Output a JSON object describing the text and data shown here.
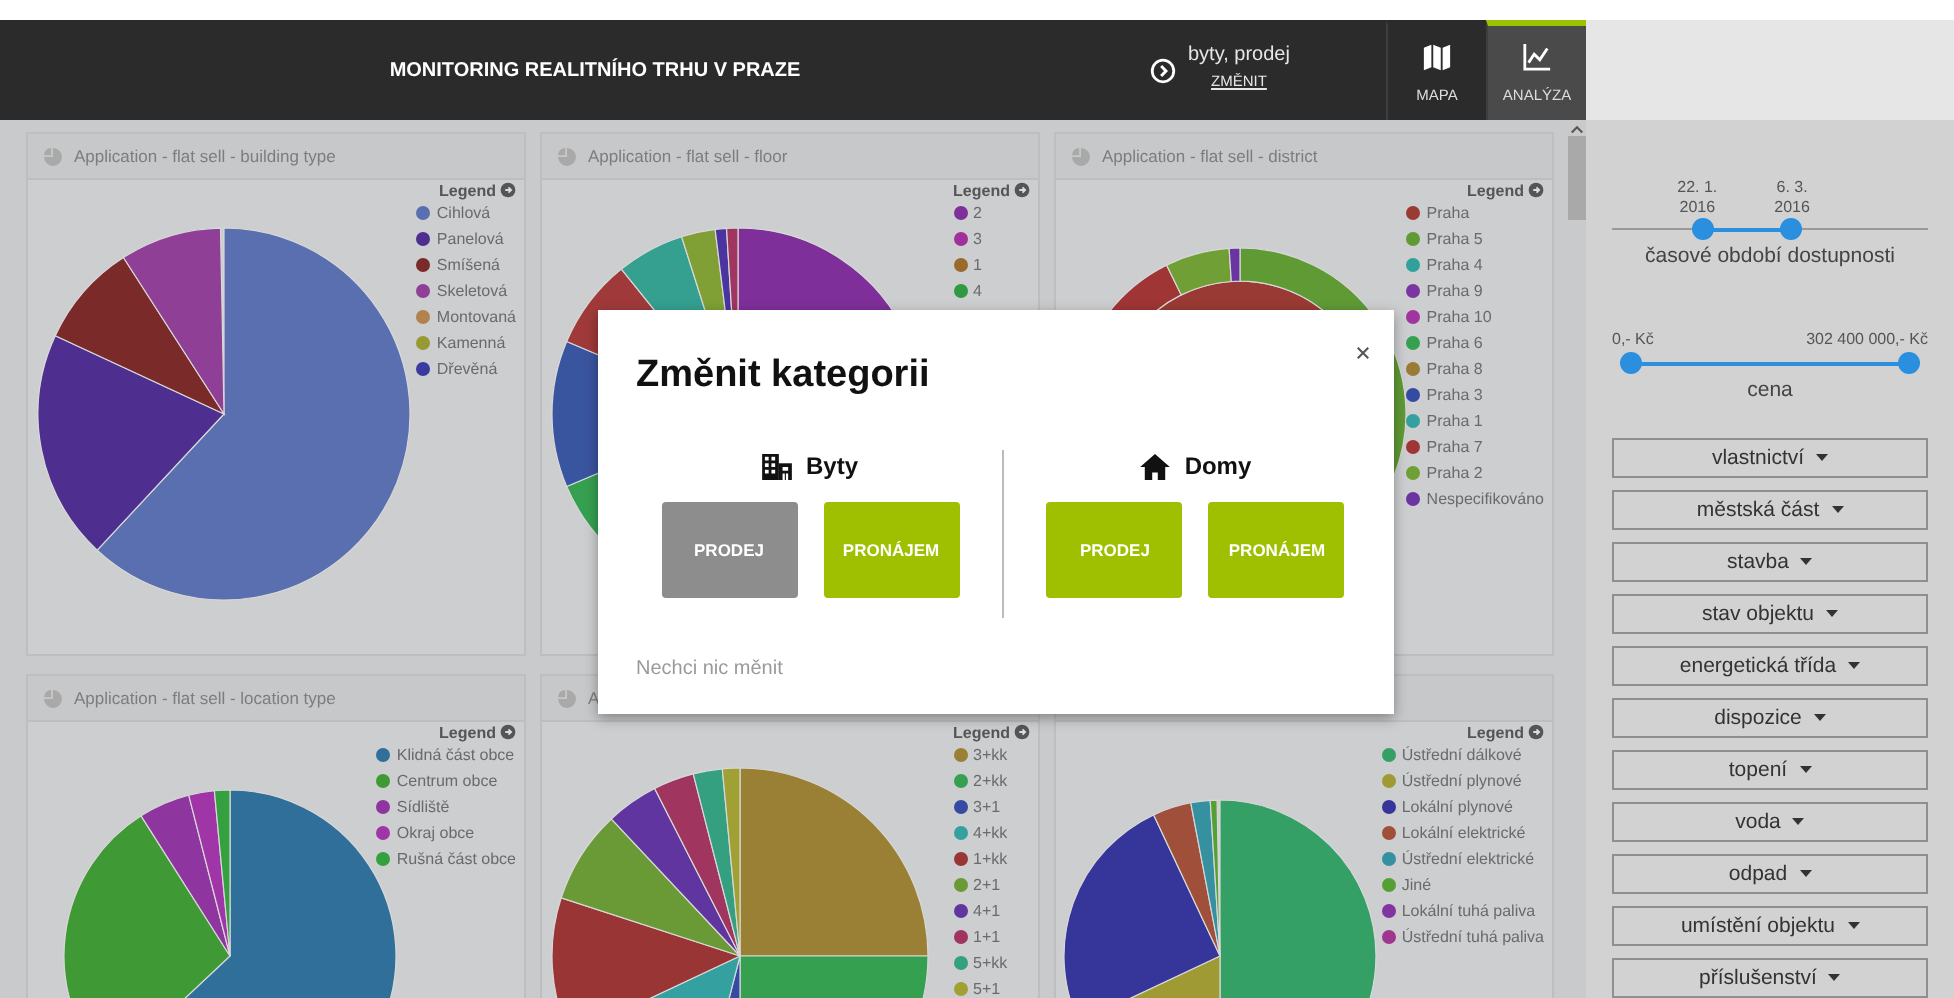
{
  "header": {
    "title": "MONITORING REALITNÍHO TRHU V PRAZE",
    "category": "byty, prodej",
    "change_link": "ZMĚNIT",
    "tabs": [
      {
        "label": "MAPA",
        "kind": "map",
        "selected": false
      },
      {
        "label": "ANALÝZA",
        "kind": "chart",
        "selected": true
      }
    ]
  },
  "charts": [
    {
      "title": "Application - flat sell - building type",
      "kind": "pie",
      "legend_title": "Legend",
      "legend": [
        {
          "label": "Cihlová",
          "color": "#5a6faf"
        },
        {
          "label": "Panelová",
          "color": "#4e2f8f"
        },
        {
          "label": "Smíšená",
          "color": "#7b2a2a"
        },
        {
          "label": "Skeletová",
          "color": "#8f3f95"
        },
        {
          "label": "Montovaná",
          "color": "#b0824e"
        },
        {
          "label": "Kamenná",
          "color": "#999933"
        },
        {
          "label": "Dřevěná",
          "color": "#3a3aa0"
        }
      ]
    },
    {
      "title": "Application - flat sell - floor",
      "kind": "pie",
      "legend_title": "Legend",
      "legend": [
        {
          "label": "2",
          "color": "#7f2f9a"
        },
        {
          "label": "3",
          "color": "#a0309a"
        },
        {
          "label": "1",
          "color": "#9a6a2a"
        },
        {
          "label": "4",
          "color": "#2f9a3f"
        }
      ]
    },
    {
      "title": "Application - flat sell - district",
      "kind": "donut",
      "legend_title": "Legend",
      "legend": [
        {
          "label": "Praha",
          "color": "#9a3a35"
        },
        {
          "label": "Praha 5",
          "color": "#5f9a35"
        },
        {
          "label": "Praha 4",
          "color": "#30a09a"
        },
        {
          "label": "Praha 9",
          "color": "#7a35a0"
        },
        {
          "label": "Praha 10",
          "color": "#a035a0"
        },
        {
          "label": "Praha 6",
          "color": "#35a050"
        },
        {
          "label": "Praha 8",
          "color": "#9a7a35"
        },
        {
          "label": "Praha 3",
          "color": "#354aa0"
        },
        {
          "label": "Praha 1",
          "color": "#35a0a0"
        },
        {
          "label": "Praha 7",
          "color": "#a03535"
        },
        {
          "label": "Praha 2",
          "color": "#70a035"
        },
        {
          "label": "Nespecifikováno",
          "color": "#6a35a0"
        }
      ]
    },
    {
      "title": "Application - flat sell - location type",
      "kind": "pie",
      "legend_title": "Legend",
      "legend": [
        {
          "label": "Klidná část obce",
          "color": "#2f6f9a"
        },
        {
          "label": "Centrum obce",
          "color": "#3f9a35"
        },
        {
          "label": "Sídliště",
          "color": "#8f35a0"
        },
        {
          "label": "Okraj obce",
          "color": "#a035a8"
        },
        {
          "label": "Rušná část obce",
          "color": "#35a040"
        }
      ]
    },
    {
      "title": "A",
      "kind": "pie",
      "legend_title": "Legend",
      "legend": [
        {
          "label": "3+kk",
          "color": "#9a8035"
        },
        {
          "label": "2+kk",
          "color": "#35a050"
        },
        {
          "label": "3+1",
          "color": "#354aa0"
        },
        {
          "label": "4+kk",
          "color": "#35a0a0"
        },
        {
          "label": "1+kk",
          "color": "#9a3535"
        },
        {
          "label": "2+1",
          "color": "#6a9a35"
        },
        {
          "label": "4+1",
          "color": "#6035a0"
        },
        {
          "label": "1+1",
          "color": "#a03560"
        },
        {
          "label": "5+kk",
          "color": "#35a080"
        },
        {
          "label": "5+1",
          "color": "#a0a035"
        }
      ]
    },
    {
      "kind": "pie",
      "legend_title": "Legend",
      "legend": [
        {
          "label": "Ústřední dálkové",
          "color": "#35a065"
        },
        {
          "label": "Ústřední plynové",
          "color": "#a09a35"
        },
        {
          "label": "Lokální plynové",
          "color": "#35359a"
        },
        {
          "label": "Lokální elektrické",
          "color": "#a0503a"
        },
        {
          "label": "Ústřední elektrické",
          "color": "#3590a0"
        },
        {
          "label": "Jiné",
          "color": "#55a035"
        },
        {
          "label": "Lokální tuhá paliva",
          "color": "#8035a0"
        },
        {
          "label": "Ústřední tuhá paliva",
          "color": "#a03590"
        }
      ]
    }
  ],
  "sidebar": {
    "sliders": [
      {
        "label": "časové období dostupnosti",
        "thumbs": [
          {
            "label": "22. 1. 2016",
            "level": 0.27
          },
          {
            "label": "6. 3. 2016",
            "level": 0.57
          }
        ]
      },
      {
        "label": "cena",
        "min_label": "0,- Kč",
        "max_label": "302 400 000,- Kč",
        "thumbs": [
          {
            "level": 0
          },
          {
            "level": 1
          }
        ]
      }
    ],
    "filters": [
      "vlastnictví",
      "městská část",
      "stavba",
      "stav objektu",
      "energetická třída",
      "dispozice",
      "topení",
      "voda",
      "odpad",
      "umístění objektu",
      "příslušenství"
    ]
  },
  "modal": {
    "title": "Změnit kategorii",
    "groups": [
      {
        "label": "Byty",
        "kind": "flats",
        "options": [
          {
            "label": "PRODEJ",
            "selected": true
          },
          {
            "label": "PRONÁJEM",
            "selected": false
          }
        ]
      },
      {
        "label": "Domy",
        "kind": "houses",
        "options": [
          {
            "label": "PRODEJ",
            "selected": false
          },
          {
            "label": "PRONÁJEM",
            "selected": false
          }
        ]
      }
    ],
    "cancel": "Nechci nic měnit"
  }
}
